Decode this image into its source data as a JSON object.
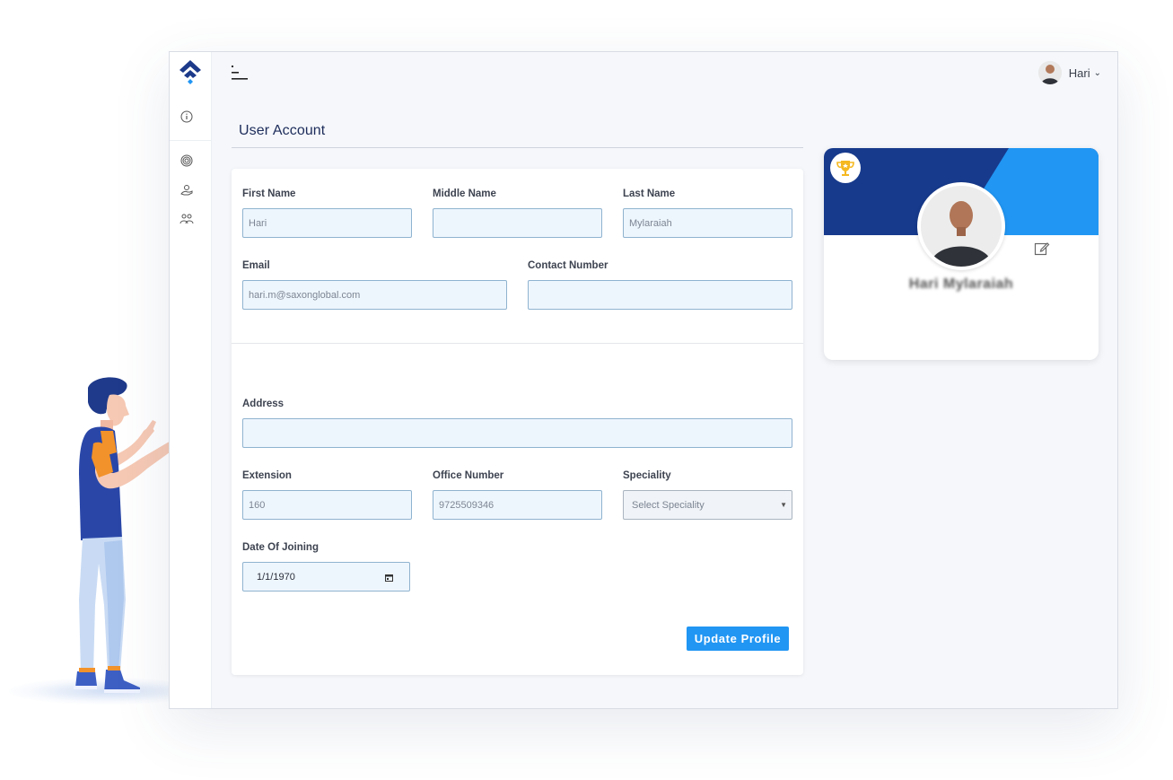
{
  "header": {
    "user_name": "Hari",
    "icons": {
      "menu": "menu-toggle-icon",
      "dropdown": "chevron-down-icon"
    }
  },
  "sidebar": {
    "items": [
      {
        "icon": "info-icon"
      },
      {
        "icon": "target-icon"
      },
      {
        "icon": "hand-coin-icon"
      },
      {
        "icon": "team-icon"
      }
    ]
  },
  "page": {
    "title": "User Account"
  },
  "form": {
    "first_name": {
      "label": "First Name",
      "value": "Hari"
    },
    "middle_name": {
      "label": "Middle Name",
      "value": ""
    },
    "last_name": {
      "label": "Last Name",
      "value": "Mylaraiah"
    },
    "email": {
      "label": "Email",
      "value": "hari.m@saxonglobal.com"
    },
    "contact_number": {
      "label": "Contact Number",
      "value": ""
    },
    "address": {
      "label": "Address",
      "value": ""
    },
    "extension": {
      "label": "Extension",
      "value": "160"
    },
    "office_number": {
      "label": "Office Number",
      "value": "9725509346"
    },
    "speciality": {
      "label": "Speciality",
      "value": "Select Speciality"
    },
    "date_of_joining": {
      "label": "Date Of Joining",
      "value": "1/1/1970"
    },
    "submit_label": "Update Profile"
  },
  "profile_card": {
    "name": "Hari Mylaraiah",
    "colors": {
      "banner_dark": "#173a8c",
      "banner_light": "#2196f3"
    }
  },
  "colors": {
    "accent": "#2196f3",
    "title": "#1d2c5a",
    "input_bg": "#eef6fd",
    "input_border": "#8fb3cf"
  }
}
